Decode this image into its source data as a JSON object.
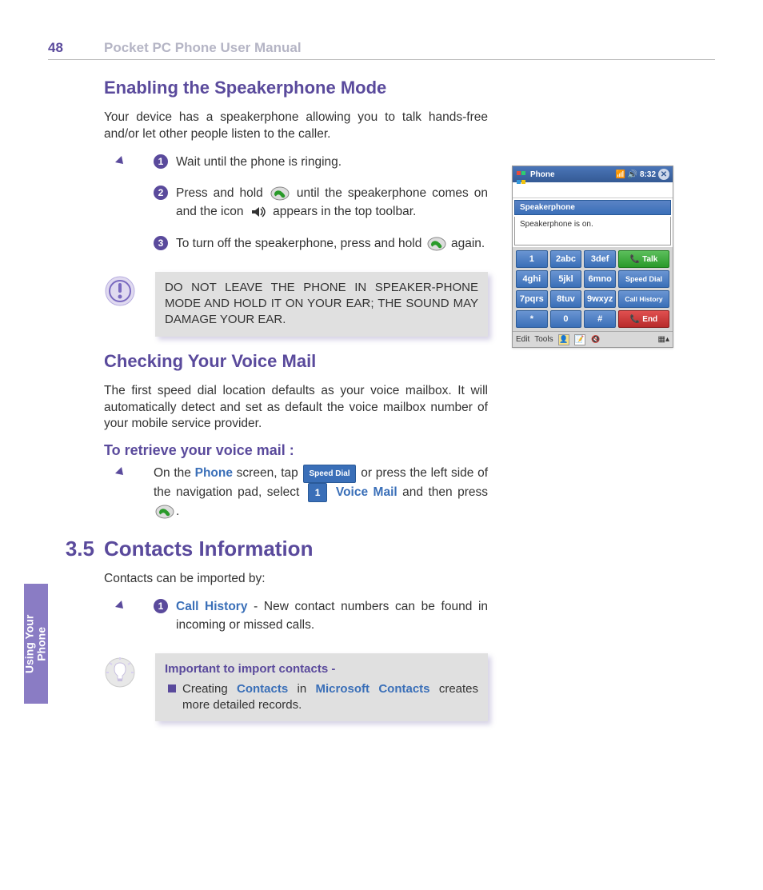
{
  "header": {
    "page_number": "48",
    "manual_title": "Pocket PC Phone User Manual"
  },
  "side_tab": "Using Your\nPhone",
  "sec_speaker": {
    "heading": "Enabling the Speakerphone Mode",
    "intro": "Your device has a speakerphone allowing you to talk hands-free and/or let other people listen to the caller.",
    "steps": {
      "s1": "Wait  until  the phone is ringing.",
      "s2a": "Press and hold ",
      "s2b": " until the speakerphone comes on and the icon ",
      "s2c": " appears in the top toolbar.",
      "s3a": "To turn off the speakerphone, press and hold ",
      "s3b": "again."
    },
    "warning": "DO NOT LEAVE THE PHONE IN SPEAKER-PHONE MODE AND HOLD IT ON YOUR EAR; THE SOUND MAY DAMAGE YOUR EAR."
  },
  "sec_voicemail": {
    "heading": "Checking Your Voice Mail",
    "intro": "The first speed dial location defaults as your voice mailbox. It will automatically detect and set as default  the voice mailbox number of your mobile service provider.",
    "sub": "To retrieve your voice mail :",
    "text1": "On the ",
    "phone_word": "Phone",
    "text2": " screen, tap ",
    "speed_dial_label": "Speed Dial",
    "text3": " or press the left side of the navigation pad, select ",
    "key1": "1",
    "voice_mail_word": "Voice Mail",
    "text4": " and then press ",
    "text5": "."
  },
  "sec_contacts": {
    "num": "3.5",
    "title": "Contacts Information",
    "intro": "Contacts can be imported by:",
    "step1_bold": "Call History",
    "step1_rest": " - New contact numbers can be found in incoming or missed calls.",
    "tip_title": "Important to import contacts -",
    "tip_a": "Creating ",
    "tip_contacts": "Contacts",
    "tip_b": " in ",
    "tip_ms": "Microsoft Contacts",
    "tip_c": " creates more detailed records."
  },
  "phone": {
    "topbar_title": "Phone",
    "time": "8:32",
    "display_placeholder": "",
    "popup_title": "Speakerphone",
    "popup_body": "Speakerphone is on.",
    "keys": [
      "1",
      "2abc",
      "3def",
      "4ghi",
      "5jkl",
      "6mno",
      "7pqrs",
      "8tuv",
      "9wxyz",
      "*",
      "0",
      "#"
    ],
    "talk": "Talk",
    "speed_dial": "Speed Dial",
    "call_history": "Call History",
    "end": "End",
    "menu_edit": "Edit",
    "menu_tools": "Tools"
  }
}
